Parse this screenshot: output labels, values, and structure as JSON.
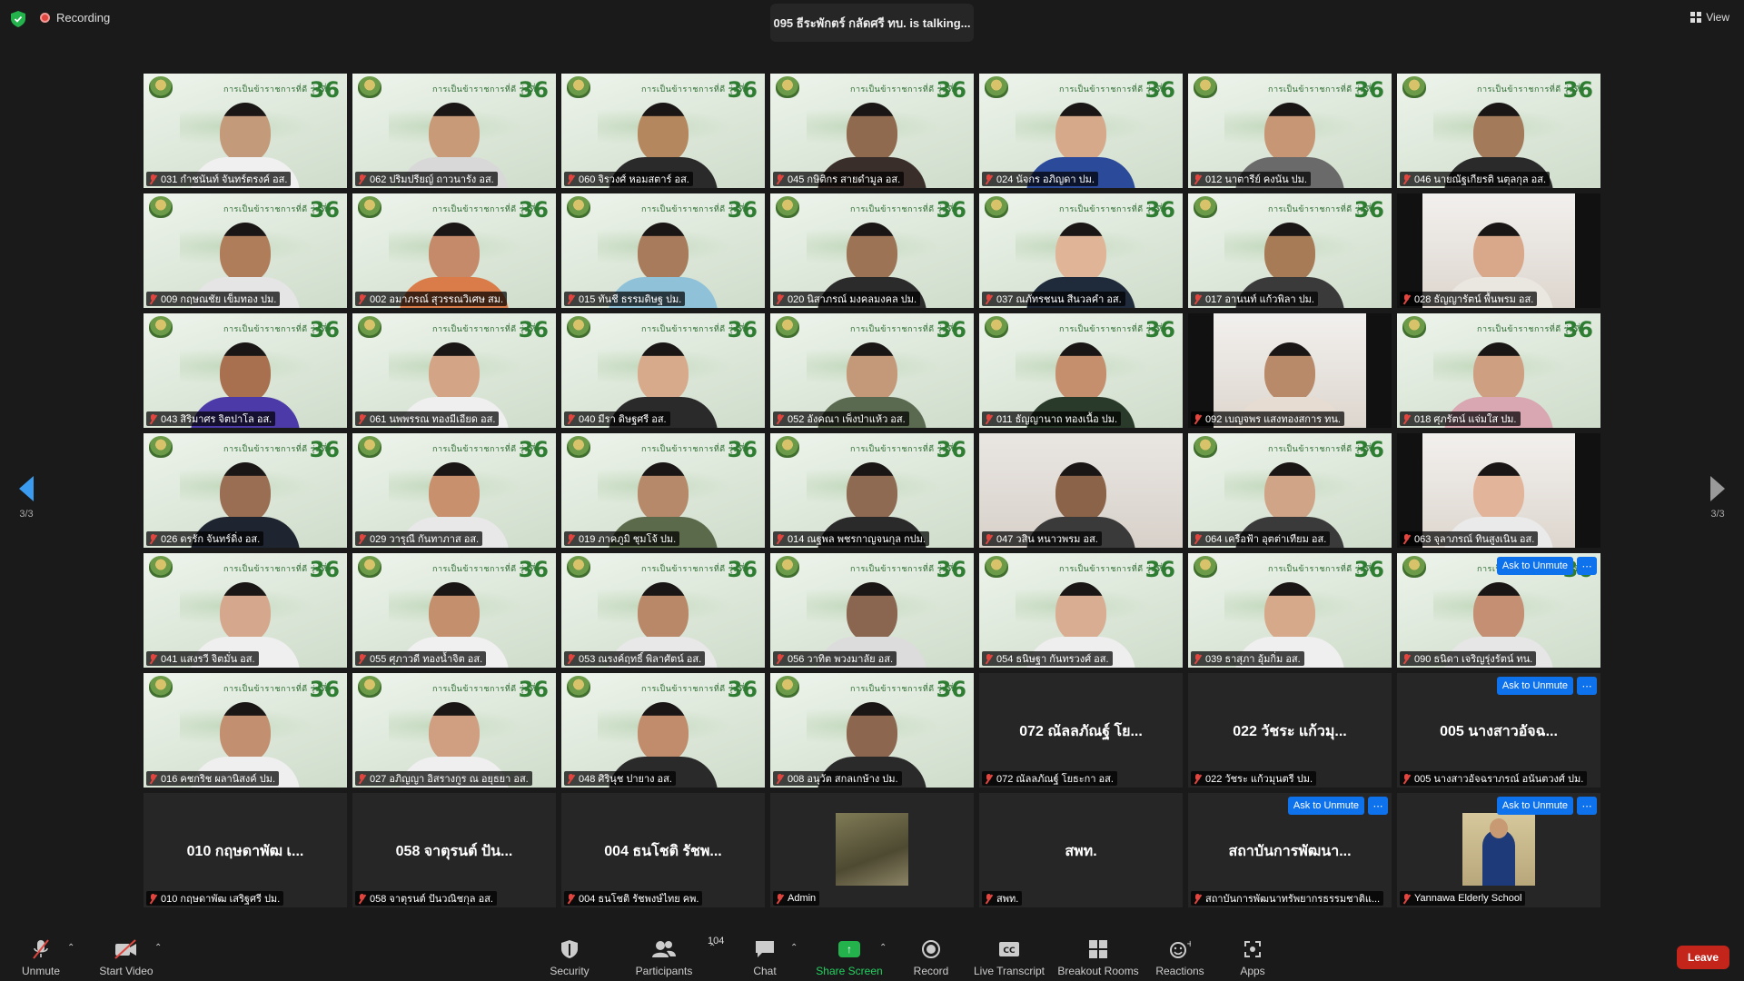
{
  "top": {
    "recording_label": "Recording",
    "talking_text": "095 ธีระพักตร์ กลัดศรี ทบ. is  talking...",
    "view_label": "View"
  },
  "nav": {
    "page_indicator": "3/3"
  },
  "tiles": [
    {
      "name": "031 กำชนันท์ จันทร์ตรงค์ อส.",
      "type": "video",
      "skin": "#c39a7a",
      "shirt": "#f0f0f0"
    },
    {
      "name": "062 ปริมปรียญ์ ถาวนารัง อส.",
      "type": "video",
      "skin": "#c89a78",
      "shirt": "#d8d8d8"
    },
    {
      "name": "060 จิรวงศ์ หอมสตาร์ อส.",
      "type": "video",
      "skin": "#b5875f",
      "shirt": "#2a2a2a"
    },
    {
      "name": "045 กษิติกร สายดำมูล อส.",
      "type": "video",
      "skin": "#8f6a4e",
      "shirt": "#3a2e2a"
    },
    {
      "name": "024 นัจกร อภิญดา ปม.",
      "type": "video",
      "skin": "#d6a98a",
      "shirt": "#2c4a9a"
    },
    {
      "name": "012 นาตารีย์ คงนัน ปม.",
      "type": "video",
      "skin": "#c79675",
      "shirt": "#6a6a6a"
    },
    {
      "name": "046 นายณัฐเกียรติ นตุลกุล อส.",
      "type": "video",
      "skin": "#a37a5a",
      "shirt": "#2a2a2a"
    },
    {
      "name": "009 กฤษณชัย เข็มทอง ปม.",
      "type": "video",
      "skin": "#b07d5b",
      "shirt": "#e5e5e5"
    },
    {
      "name": "002 อมาภรณ์ สุวรรณวิเศษ สม.",
      "type": "video",
      "skin": "#c58a69",
      "shirt": "#d97c49"
    },
    {
      "name": "015 ทันชี ธรรมดิษฐ ปม.",
      "type": "video",
      "skin": "#a77b5b",
      "shirt": "#8fc2d9"
    },
    {
      "name": "020 นิสาภรณ์ มงคลมงคล ปม.",
      "type": "video",
      "skin": "#9c7455",
      "shirt": "#2b2b2b"
    },
    {
      "name": "037 ณภัทรชนน สีนวลคำ อส.",
      "type": "video",
      "skin": "#e0b496",
      "shirt": "#1f2a3a"
    },
    {
      "name": "017 อานนท์ แก้วพิลา ปม.",
      "type": "video",
      "skin": "#a87b57",
      "shirt": "#3a3a3a"
    },
    {
      "name": "028 ธัญญารัตน์ พื้นพรม อส.",
      "type": "boxed",
      "skin": "#d9a88a",
      "shirt": "#eae6e0"
    },
    {
      "name": "043 สิริมาศร จิตปาโล อส.",
      "type": "video",
      "skin": "#a8704f",
      "shirt": "#4b3aa8"
    },
    {
      "name": "061 นพพรรณ ทองมีเอียด อส.",
      "type": "video",
      "skin": "#d4a486",
      "shirt": "#efefef"
    },
    {
      "name": "040 มีรา ดิษฐศรี อส.",
      "type": "video",
      "skin": "#d8aa8c",
      "shirt": "#2a2a2a"
    },
    {
      "name": "052 อังคณา เพ็งป่าแห้ว อส.",
      "type": "video",
      "skin": "#c49979",
      "shirt": "#5a6a50"
    },
    {
      "name": "011 ธัญญานาถ ทองเนื้อ ปม.",
      "type": "video",
      "skin": "#c58f6e",
      "shirt": "#2a3a2a"
    },
    {
      "name": "092 เบญจพร แสงทองสการ ทน.",
      "type": "boxed",
      "skin": "#b88a6a",
      "shirt": "#e6dcd2"
    },
    {
      "name": "018 ศุภรัตน์ แจ่มใส ปม.",
      "type": "video",
      "skin": "#cf9f82",
      "shirt": "#d8a7b2"
    },
    {
      "name": "026 ดรรัก จันทร์ดิ่ง อส.",
      "type": "video",
      "skin": "#9a6e52",
      "shirt": "#1e2430"
    },
    {
      "name": "029 วารุณี กันทาภาส อส.",
      "type": "video",
      "skin": "#c9906e",
      "shirt": "#e8e8e8"
    },
    {
      "name": "019 ภาคภูมิ ชุมโจ้ ปม.",
      "type": "video",
      "skin": "#b5896a",
      "shirt": "#5a6a4a"
    },
    {
      "name": "014 ณฐพล พชรกาญจนกุล กปม.",
      "type": "video",
      "skin": "#8f6a52",
      "shirt": "#2a2a2a"
    },
    {
      "name": "047 วสิน หนาวพรม อส.",
      "type": "photo",
      "skin": "#8a6348",
      "shirt": "#3a3a3a"
    },
    {
      "name": "064 เครือฟ้า อุตต่าเทียม อส.",
      "type": "video",
      "skin": "#d0a487",
      "shirt": "#3a3a3a"
    },
    {
      "name": "063 จุลาภรณ์ ทินสูงเนิน อส.",
      "type": "boxed",
      "skin": "#e2b59a",
      "shirt": "#eaeaea"
    },
    {
      "name": "041 แสงรวี จิตมั่น อส.",
      "type": "video",
      "skin": "#d5a88d",
      "shirt": "#efefef"
    },
    {
      "name": "055 ศุภาวดี ทองน้ำจิต อส.",
      "type": "video",
      "skin": "#c48f6d",
      "shirt": "#f0f0f0"
    },
    {
      "name": "053 ณรงค์ฤทธิ์ พิลาศัตน์ อส.",
      "type": "video",
      "skin": "#b98868",
      "shirt": "#e8e8e8"
    },
    {
      "name": "056 วาทิต พวงมาลัย อส.",
      "type": "video",
      "skin": "#8a6550",
      "shirt": "#dcdcdc"
    },
    {
      "name": "054 ธนิษฐา กันทรวงศ์ อส.",
      "type": "video",
      "skin": "#d9ad92",
      "shirt": "#eeeeee"
    },
    {
      "name": "039 ธาสุภา อุ้มกิ่ม อส.",
      "type": "video",
      "skin": "#d6a98b",
      "shirt": "#efefef"
    },
    {
      "name": "090 ธนิดา เจริญรุ่งรัตน์ ทน.",
      "type": "video",
      "skin": "#c48f72",
      "shirt": "#e6e6e6",
      "ask": "Ask to Unmute",
      "more": "⋯"
    },
    {
      "name": "016 คชกริช ผลานิสงค์ ปม.",
      "type": "video",
      "skin": "#c29070",
      "shirt": "#efefef"
    },
    {
      "name": "027 อภิญญา อิสรางกูร ณ อยุธยา อส.",
      "type": "video",
      "skin": "#d09e80",
      "shirt": "#efefef"
    },
    {
      "name": "048 ศิรินุช ปายาง อส.",
      "type": "video",
      "skin": "#c08c6b",
      "shirt": "#2a2a2a"
    },
    {
      "name": "008 อนุวัต สกลเกษ้าง ปม.",
      "type": "video",
      "skin": "#8d6650",
      "shirt": "#2a2a2a"
    },
    {
      "name": "072 ณัลลภัณฐ์ โยธะกา อส.",
      "type": "blank",
      "big": "072 ณัลลภัณฐ์ โย..."
    },
    {
      "name": "022 วัชระ แก้วมุนตรี ปม.",
      "type": "blank",
      "big": "022 วัชระ แก้วมุ..."
    },
    {
      "name": "005 นางสาวอัจฉราภรณ์ อนันตวงศ์ ปม.",
      "type": "blank",
      "big": "005 นางสาวอัจฉ...",
      "ask": "Ask to Unmute",
      "more": "⋯"
    },
    {
      "name": "010 กฤษดาพัฒ เสริฐศรี ปม.",
      "type": "blank",
      "big": "010 กฤษดาพัฒ เ..."
    },
    {
      "name": "058 จาตุรนต์ ปันวณิชกุล อส.",
      "type": "blank",
      "big": "058 จาตุรนต์ ปัน..."
    },
    {
      "name": "004 ธนโชติ รัชพงษ์ไทย คพ.",
      "type": "blank",
      "big": "004 ธนโชติ รัชพ..."
    },
    {
      "name": "Admin",
      "type": "thumb",
      "thumb": "t1"
    },
    {
      "name": "สพท.",
      "type": "blank",
      "big": "สพท."
    },
    {
      "name": "สถาบันการพัฒนาทรัพยากรธรรมชาติแ...",
      "type": "blank",
      "big": "สถาบันการพัฒนา...",
      "ask": "Ask to Unmute",
      "more": "⋯"
    },
    {
      "name": "Yannawa Elderly School",
      "type": "thumb",
      "thumb": "t2",
      "ask": "Ask to Unmute",
      "more": "⋯"
    }
  ],
  "banner": {
    "text": "การเป็นข้าราชการที่ดี รุ่นที่",
    "number": "36"
  },
  "toolbar": {
    "unmute": "Unmute",
    "start_video": "Start Video",
    "security": "Security",
    "participants": "Participants",
    "participants_count": "104",
    "chat": "Chat",
    "share_screen": "Share Screen",
    "record": "Record",
    "live_transcript": "Live Transcript",
    "breakout_rooms": "Breakout Rooms",
    "reactions": "Reactions",
    "apps": "Apps",
    "leave": "Leave"
  },
  "colors": {
    "accent": "#0e72ed",
    "muted": "#e0463f",
    "share": "#23b24c",
    "leave": "#c4251b"
  }
}
